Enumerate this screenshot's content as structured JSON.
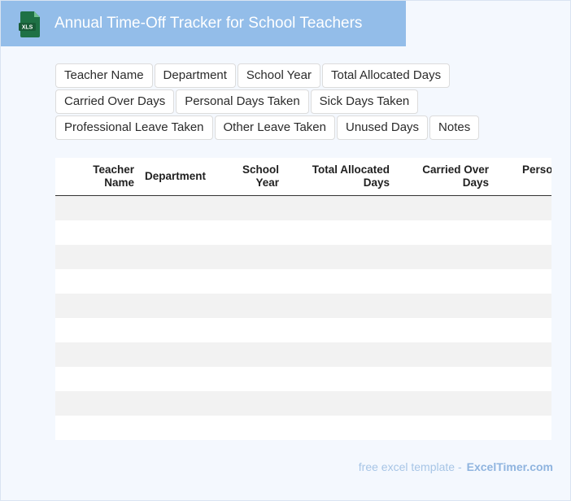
{
  "header": {
    "title": "Annual Time-Off Tracker for School Teachers",
    "icon": "xls-file-icon",
    "icon_text": "XLS",
    "accent_color": "#93bde9",
    "icon_color": "#1e7145"
  },
  "fields": [
    "Teacher Name",
    "Department",
    "School Year",
    "Total Allocated Days",
    "Carried Over Days",
    "Personal Days Taken",
    "Sick Days Taken",
    "Professional Leave Taken",
    "Other Leave Taken",
    "Unused Days",
    "Notes"
  ],
  "table": {
    "columns": [
      {
        "line1": "Teacher",
        "line2": "Name"
      },
      {
        "line1": "Department",
        "line2": ""
      },
      {
        "line1": "School",
        "line2": "Year"
      },
      {
        "line1": "Total Allocated",
        "line2": "Days"
      },
      {
        "line1": "Carried Over",
        "line2": "Days"
      },
      {
        "line1": "Perso",
        "line2": ""
      }
    ]
  },
  "footer": {
    "prefix": "free excel template -",
    "brand": "ExcelTimer.com"
  }
}
